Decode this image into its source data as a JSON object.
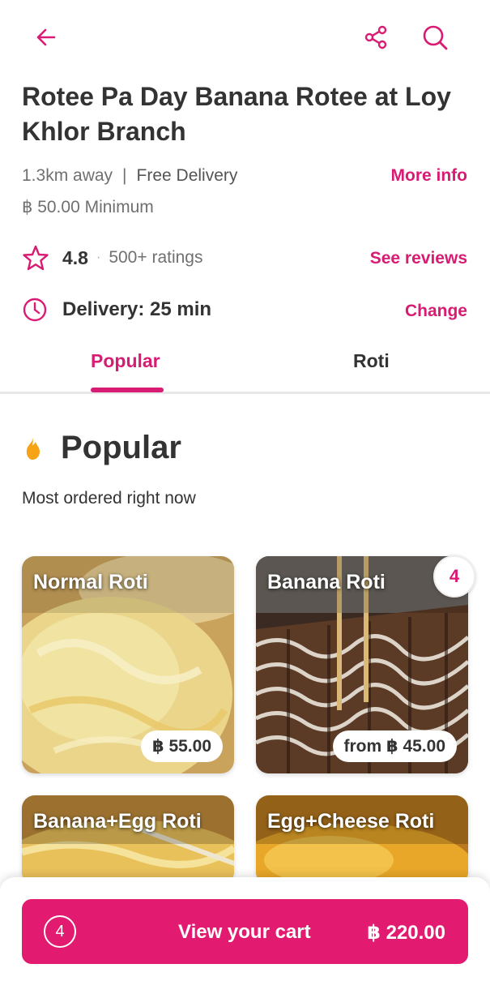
{
  "header": {
    "back_icon": "arrow-left-icon",
    "share_icon": "share-icon",
    "search_icon": "search-icon",
    "accent_color": "#d81b73"
  },
  "store": {
    "name": "Rotee Pa Day Banana Rotee at Loy Khlor Branch",
    "distance": "1.3km away",
    "separator": "|",
    "delivery_fee": "Free Delivery",
    "minimum": "฿ 50.00 Minimum",
    "more_info": "More info",
    "rating": "4.8",
    "rating_dot": "·",
    "rating_count": "500+ ratings",
    "see_reviews": "See reviews",
    "delivery_time": "Delivery: 25 min",
    "change": "Change"
  },
  "tabs": [
    {
      "label": "Popular",
      "active": true
    },
    {
      "label": "Roti",
      "active": false
    }
  ],
  "section": {
    "title": "Popular",
    "subtitle": "Most ordered right now",
    "icon": "flame-icon"
  },
  "items": [
    {
      "name": "Normal Roti",
      "price": "฿ 55.00"
    },
    {
      "name": "Banana Roti",
      "price": "from ฿ 45.00",
      "in_cart": "4"
    },
    {
      "name": "Banana+Egg Roti"
    },
    {
      "name": "Egg+Cheese Roti"
    }
  ],
  "cart": {
    "count": "4",
    "label": "View your cart",
    "total": "฿ 220.00",
    "button_color": "#e21b70"
  }
}
